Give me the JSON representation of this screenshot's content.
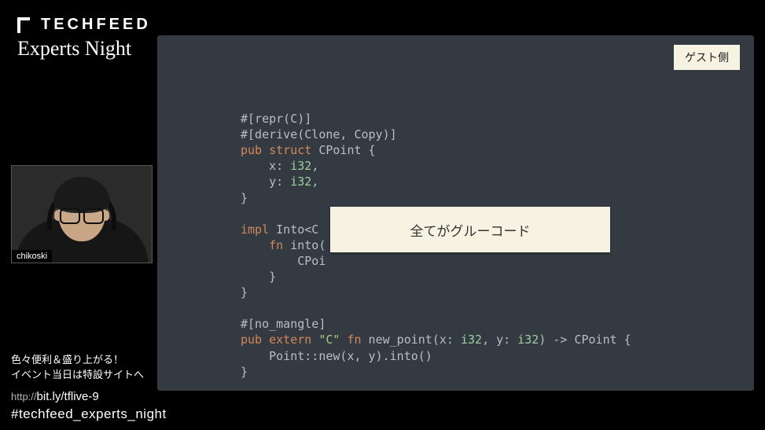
{
  "logo": {
    "brand": "TECHFEED",
    "subtitle": "Experts Night"
  },
  "webcam": {
    "username": "chikoski"
  },
  "promo": {
    "line1": "色々便利＆盛り上がる！",
    "line2": "イベント当日は特設サイトへ"
  },
  "links": {
    "url_prefix": "http://",
    "url_main": "bit.ly/tflive-9",
    "hashtag": "#techfeed_experts_night"
  },
  "slide": {
    "guest_label": "ゲスト側",
    "overlay_text": "全てがグルーコード",
    "code": {
      "l1_attr": "#[repr(C)]",
      "l2_attr": "#[derive(Clone, Copy)]",
      "l3_pub": "pub ",
      "l3_struct": "struct",
      "l3_name": " CPoint {",
      "l4": "    x: ",
      "l4_ty": "i32",
      "l4_end": ",",
      "l5": "    y: ",
      "l5_ty": "i32",
      "l5_end": ",",
      "l6": "}",
      "l8_impl": "impl",
      "l8_rest": " Into<C",
      "l9_fn": "    fn",
      "l9_rest": " into(",
      "l10": "        CPoi",
      "l11": "    }",
      "l12": "}",
      "l14_attr": "#[no_mangle]",
      "l15_pub": "pub ",
      "l15_extern": "extern",
      "l15_abi": " \"C\" ",
      "l15_fn": "fn",
      "l15_name": " new_point(x: ",
      "l15_t1": "i32",
      "l15_m": ", y: ",
      "l15_t2": "i32",
      "l15_ret": ") -> CPoint {",
      "l16": "    Point::new(x, y).into()",
      "l17": "}"
    }
  }
}
